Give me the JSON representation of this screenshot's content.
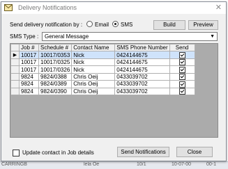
{
  "window": {
    "title": "Delivery Notifications",
    "close_glyph": "✕",
    "title_icon": "envelope-icon"
  },
  "send_by": {
    "label": "Send delivery notification by :",
    "options": [
      "Email",
      "SMS"
    ],
    "selected": "SMS"
  },
  "buttons": {
    "build": "Build",
    "preview": "Preview",
    "send": "Send Notifications",
    "close": "Close"
  },
  "sms_type": {
    "label": "SMS Type :",
    "value": "General Message"
  },
  "grid": {
    "columns": [
      "Job #",
      "Schedule #",
      "Contact Name",
      "SMS Phone Number",
      "Send"
    ],
    "rows": [
      {
        "job": "10017",
        "schedule": "10017/0353",
        "contact": "Nick",
        "phone": "0424144675",
        "send": true,
        "current": true
      },
      {
        "job": "10017",
        "schedule": "10017/0325",
        "contact": "Nick",
        "phone": "0424144675",
        "send": true,
        "current": false
      },
      {
        "job": "10017",
        "schedule": "10017/0326",
        "contact": "Nick",
        "phone": "0424144675",
        "send": true,
        "current": false
      },
      {
        "job": "9824",
        "schedule": "9824/0388",
        "contact": "Chris Oeij",
        "phone": "0433039702",
        "send": true,
        "current": false
      },
      {
        "job": "9824",
        "schedule": "9824/0389",
        "contact": "Chris Oeij",
        "phone": "0433039702",
        "send": true,
        "current": false
      },
      {
        "job": "9824",
        "schedule": "9824/0390",
        "contact": "Chris Oeij",
        "phone": "0433039702",
        "send": true,
        "current": false
      }
    ]
  },
  "update_contact": {
    "label": "Update contact in Job details",
    "checked": false
  },
  "background_strip": [
    "CARRINGB",
    "lela Oe",
    "10/1",
    "10-07-00",
    "00-1"
  ],
  "colors": {
    "selected_row": "#cfe3fb",
    "window_bg": "#f0f0f0"
  }
}
